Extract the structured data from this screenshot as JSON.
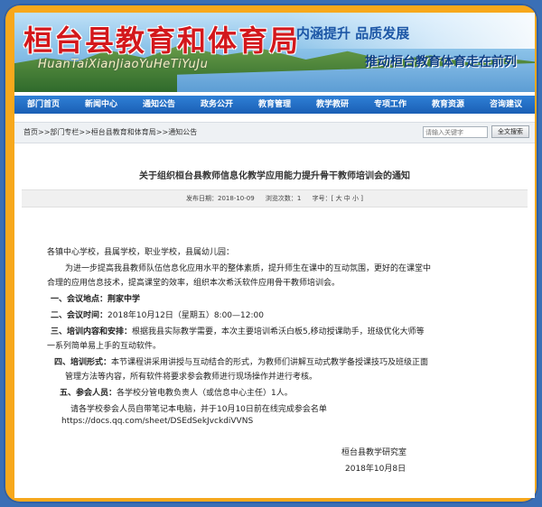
{
  "header": {
    "site_title": "桓台县教育和体育局",
    "pinyin": "HuanTaiXianJiaoYuHeTiYuJu",
    "slogan_top": "内涵提升 品质发展",
    "slogan_bottom": "推动桓台教育体育走在前列"
  },
  "nav": {
    "items": [
      "部门首页",
      "新闻中心",
      "通知公告",
      "政务公开",
      "教育管理",
      "教学教研",
      "专项工作",
      "教育资源",
      "咨询建议"
    ]
  },
  "breadcrumb": "首页>>部门专栏>>桓台县教育和体育局>>通知公告",
  "search": {
    "placeholder": "请输入关键字",
    "button_label": "全文搜索"
  },
  "article": {
    "title": "关于组织桓台县教师信息化教学应用能力提升骨干教师培训会的通知",
    "publish_date": "发布日期：2018-10-09",
    "views": "浏览次数：1",
    "font_size": "字号：[ 大 中 小 ]",
    "salutation": "各镇中心学校，县属学校，职业学校，县属幼儿园：",
    "intro_line1": "为进一步提高我县教师队伍信息化应用水平的整体素质，提升师生在课中的互动氛围，更好的在课堂中",
    "intro_line2": "合理的应用信息技术，提高课堂的效率，组织本次希沃软件应用骨干教师培训会。",
    "item1_label": "一、会议地点：",
    "item1_value": "荆家中学",
    "item2_label": "二、会议时间：",
    "item2_value": "2018年10月12日（星期五）8:00—12:00",
    "item3_label": "三、培训内容和安排：",
    "item3_value": "根据我县实际教学需要，本次主要培训希沃白板5,移动授课助手，班级优化大师等",
    "item3_line2": "一系列简单易上手的互动软件。",
    "item4_label": "四、培训形式：",
    "item4_value": "本节课程讲采用讲授与互动结合的形式，为教师们讲解互动式教学备授课技巧及班级正面",
    "item4_line2": "管理方法等内容，所有软件将要求参会教师进行现场操作并进行考核。",
    "item5_label": "五、参会人员：",
    "item5_value": "各学校分管电教负责人（或信息中心主任）1人。",
    "note": "请各学校参会人员自带笔记本电脑，并于10月10日前在线完成参会名单",
    "link": "https://docs.qq.com/sheet/DSEdSekJvckdiVVNS",
    "signature_org": "桓台县教学研究室",
    "signature_date": "2018年10月8日"
  }
}
